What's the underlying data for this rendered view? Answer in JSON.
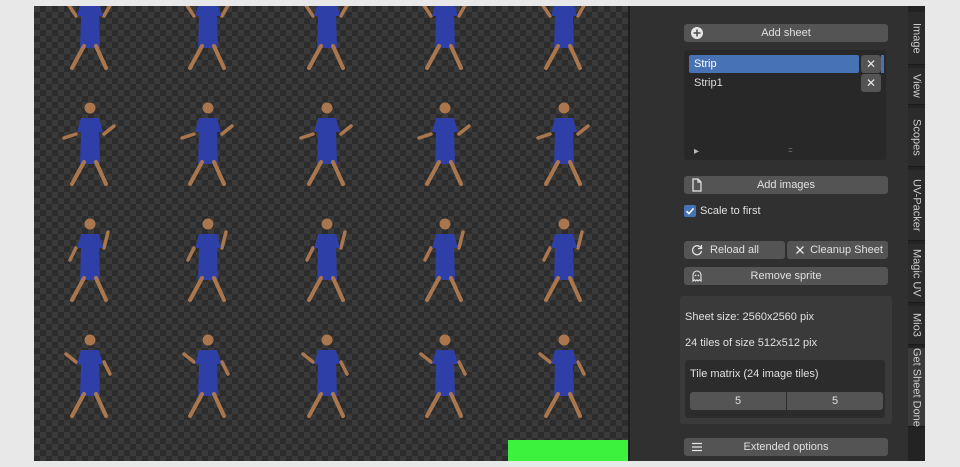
{
  "tabs": [
    {
      "label": "Image",
      "active": false
    },
    {
      "label": "View",
      "active": false
    },
    {
      "label": "Scopes",
      "active": false
    },
    {
      "label": "UV-Packer",
      "active": false
    },
    {
      "label": "Magic UV",
      "active": false
    },
    {
      "label": "Mio3",
      "active": false
    },
    {
      "label": "Get Sheet Done",
      "active": true
    }
  ],
  "sheet": {
    "add_sheet_label": "Add sheet",
    "items": [
      {
        "label": "Strip",
        "selected": true
      },
      {
        "label": "Strip1",
        "selected": false
      }
    ],
    "close_glyph": "✕",
    "expand_glyph": "▸",
    "grip_glyph": "::::"
  },
  "images": {
    "add_images_label": "Add images",
    "scale_to_first_label": "Scale to first",
    "scale_to_first_checked": true,
    "reload_all_label": "Reload all",
    "cleanup_sheet_label": "Cleanup Sheet",
    "remove_sprite_label": "Remove sprite"
  },
  "info": {
    "sheet_size": "Sheet size: 2560x2560 pix",
    "tiles_text": "24 tiles of size 512x512 pix",
    "tile_matrix_label": "Tile matrix (24 image tiles)",
    "matrix_x": "5",
    "matrix_y": "5"
  },
  "extended_options_label": "Extended options",
  "colors": {
    "accent_selected": "#4772b3",
    "checkbox": "#4772b3",
    "empty_tile_marker": "#3cf23c",
    "figure_outfit": "#2f3fa8",
    "figure_skin": "#a9764e"
  },
  "viewport": {
    "sprite_count": 24,
    "columns": 5,
    "rows_visible": 4
  }
}
